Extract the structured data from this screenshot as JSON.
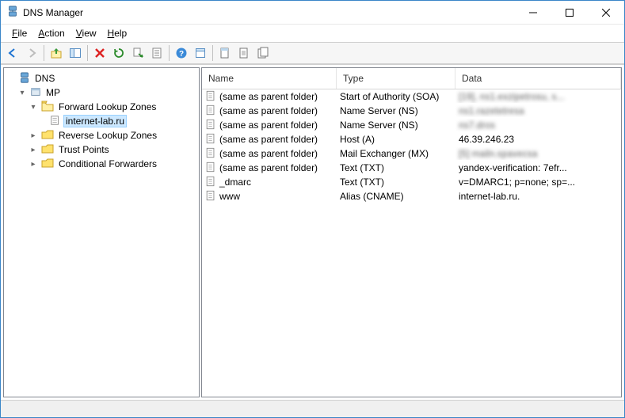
{
  "window": {
    "title": "DNS Manager"
  },
  "menu": {
    "file": "File",
    "action": "Action",
    "view": "View",
    "help": "Help"
  },
  "toolbar_icons": [
    "back-icon",
    "forward-icon",
    "|",
    "up-icon",
    "show-hide-console-tree-icon",
    "|",
    "delete-icon",
    "refresh-icon",
    "export-list-icon",
    "properties-icon",
    "|",
    "help-icon",
    "filter-icon",
    "|",
    "new-record-icon",
    "new-host-icon",
    "new-domain-icon"
  ],
  "tree": {
    "root": "DNS",
    "server": "MP",
    "nodes": [
      {
        "label": "Forward Lookup Zones",
        "expanded": true,
        "children": [
          {
            "label": "internet-lab.ru",
            "selected": true
          }
        ]
      },
      {
        "label": "Reverse Lookup Zones",
        "expanded": false
      },
      {
        "label": "Trust Points",
        "expanded": false
      },
      {
        "label": "Conditional Forwarders",
        "expanded": false
      }
    ]
  },
  "columns": {
    "name": "Name",
    "type": "Type",
    "data": "Data"
  },
  "records": [
    {
      "name": "(same as parent folder)",
      "type": "Start of Authority (SOA)",
      "data": "[19], ns1.exzipetrosu, s...",
      "blurred": true
    },
    {
      "name": "(same as parent folder)",
      "type": "Name Server (NS)",
      "data": "ns1.razetetresa",
      "blurred": true
    },
    {
      "name": "(same as parent folder)",
      "type": "Name Server (NS)",
      "data": "ns7.dros",
      "blurred": true
    },
    {
      "name": "(same as parent folder)",
      "type": "Host (A)",
      "data": "46.39.246.23",
      "blurred": false
    },
    {
      "name": "(same as parent folder)",
      "type": "Mail Exchanger (MX)",
      "data": "[5] mailn.spavecsa",
      "blurred": true
    },
    {
      "name": "(same as parent folder)",
      "type": "Text (TXT)",
      "data": "yandex-verification: 7efr...",
      "blurred": false
    },
    {
      "name": "_dmarc",
      "type": "Text (TXT)",
      "data": "v=DMARC1; p=none; sp=...",
      "blurred": false
    },
    {
      "name": "www",
      "type": "Alias (CNAME)",
      "data": "internet-lab.ru.",
      "blurred": false
    }
  ]
}
